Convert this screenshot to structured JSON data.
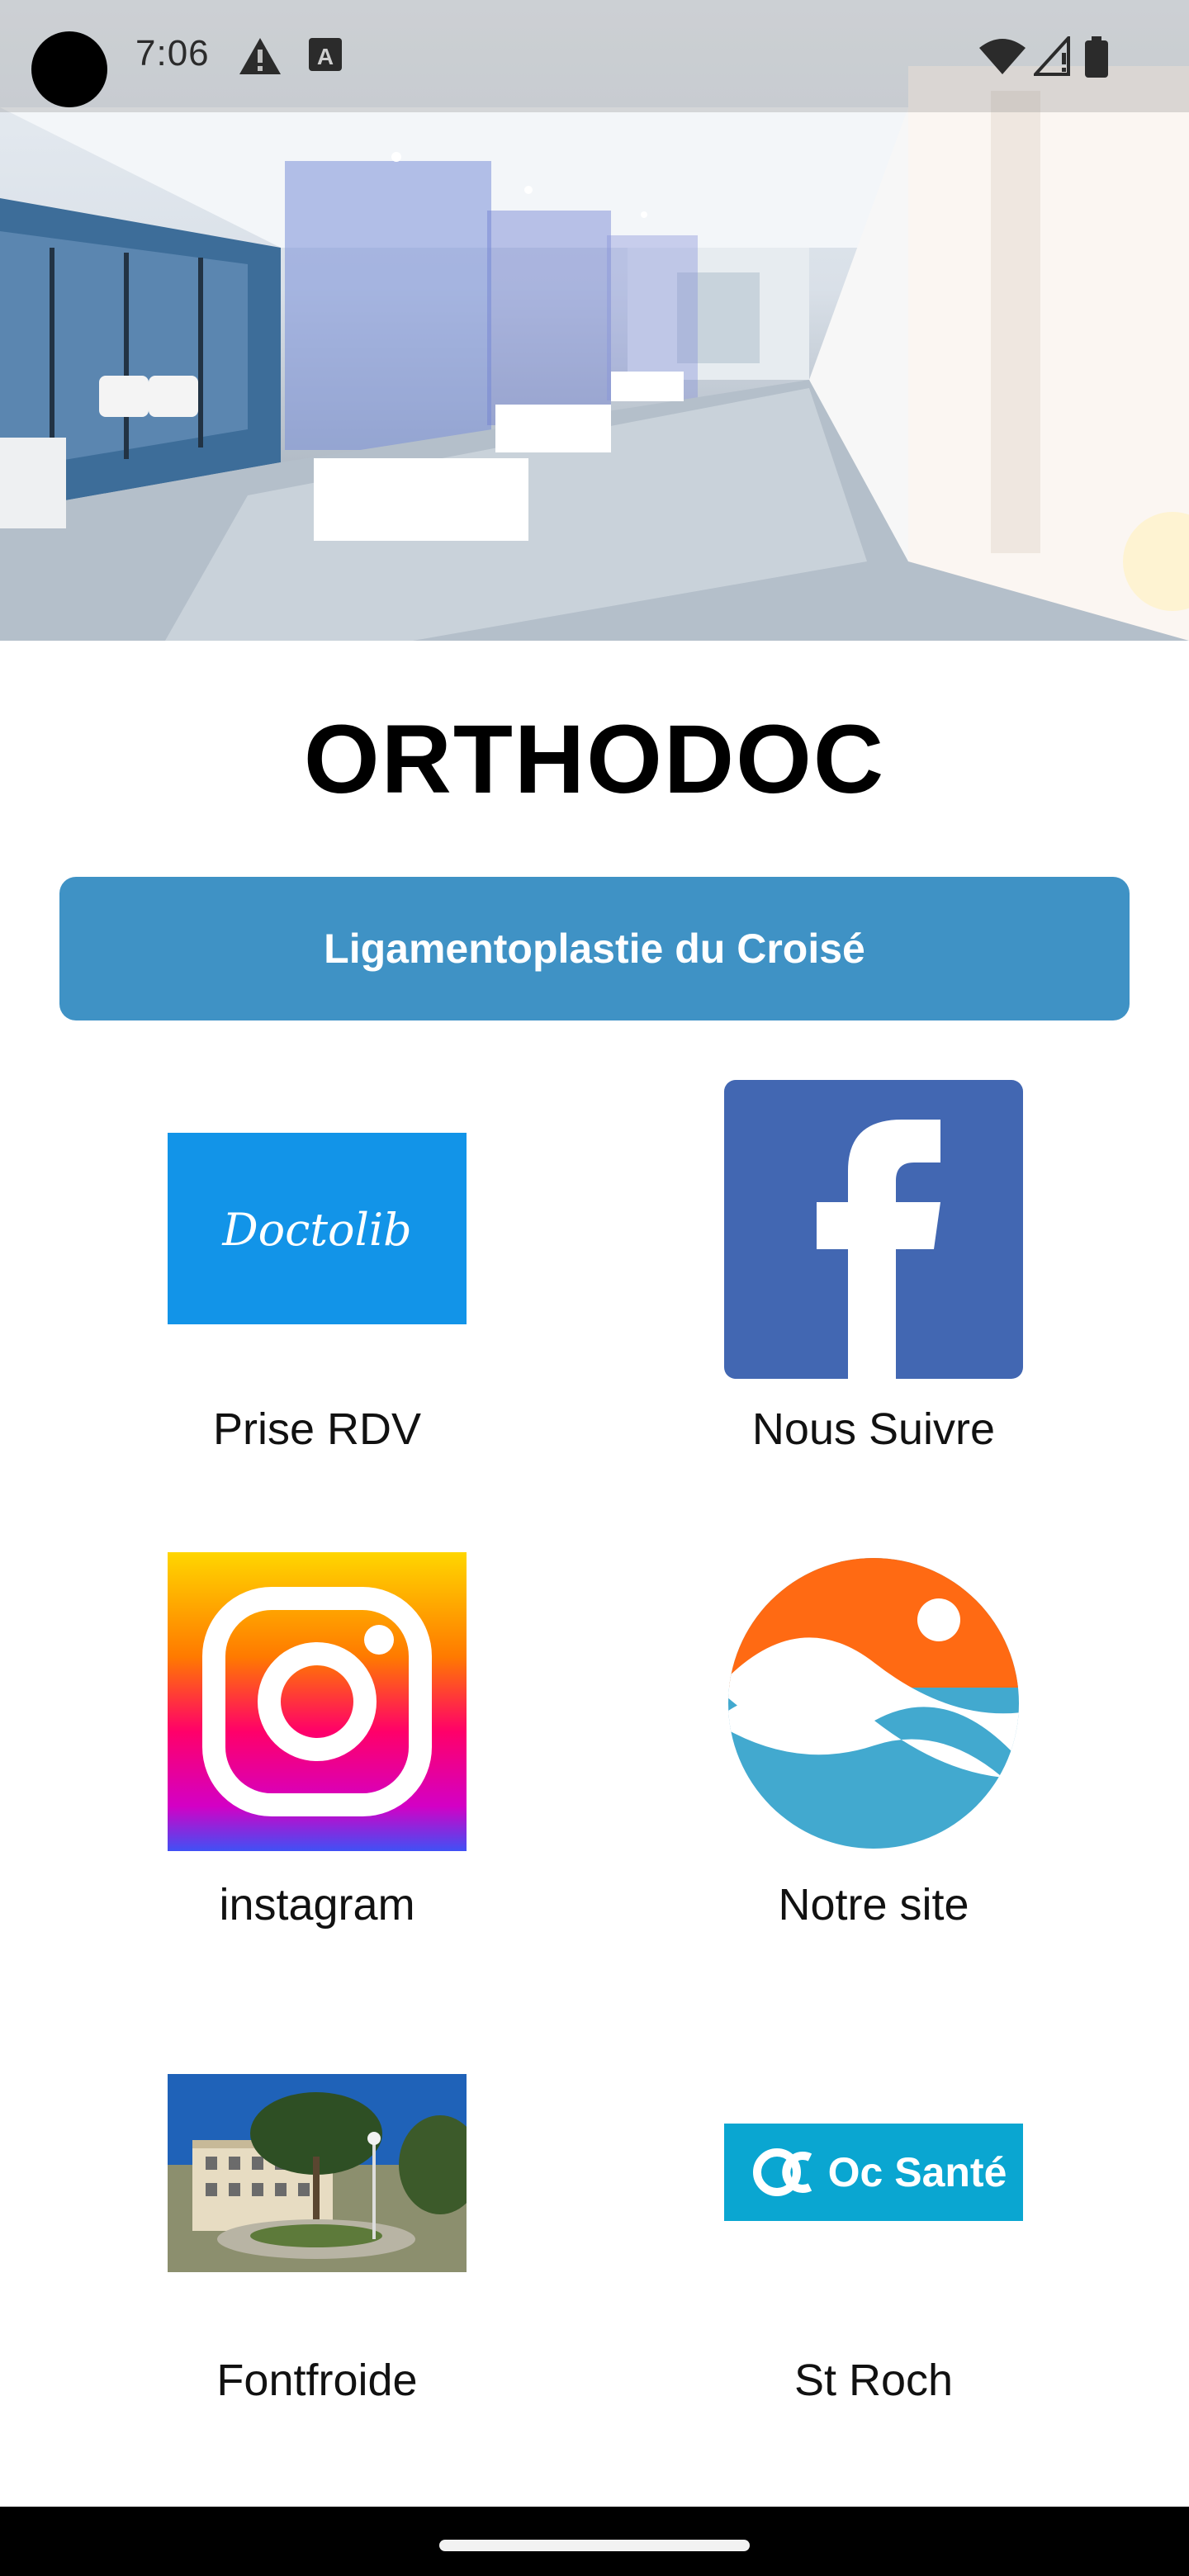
{
  "status_bar": {
    "time": "7:06",
    "icons": [
      "warning-icon",
      "text-a-icon",
      "wifi-icon",
      "cell-signal-icon",
      "battery-icon"
    ]
  },
  "app": {
    "title": "ORTHODOC",
    "primary_button_label": "Ligamentoplastie du Croisé",
    "accent_color": "#3f92c5"
  },
  "tiles": [
    {
      "label": "Prise RDV",
      "logo_text": "Doctolib",
      "icon": "doctolib-logo"
    },
    {
      "label": "Nous Suivre",
      "icon": "facebook-logo"
    },
    {
      "label": "instagram",
      "icon": "instagram-logo"
    },
    {
      "label": "Notre site",
      "icon": "website-logo"
    },
    {
      "label": "Fontfroide",
      "icon": "clinic-photo"
    },
    {
      "label": "St Roch",
      "logo_text": "Oc Santé",
      "icon": "oc-sante-logo"
    }
  ]
}
